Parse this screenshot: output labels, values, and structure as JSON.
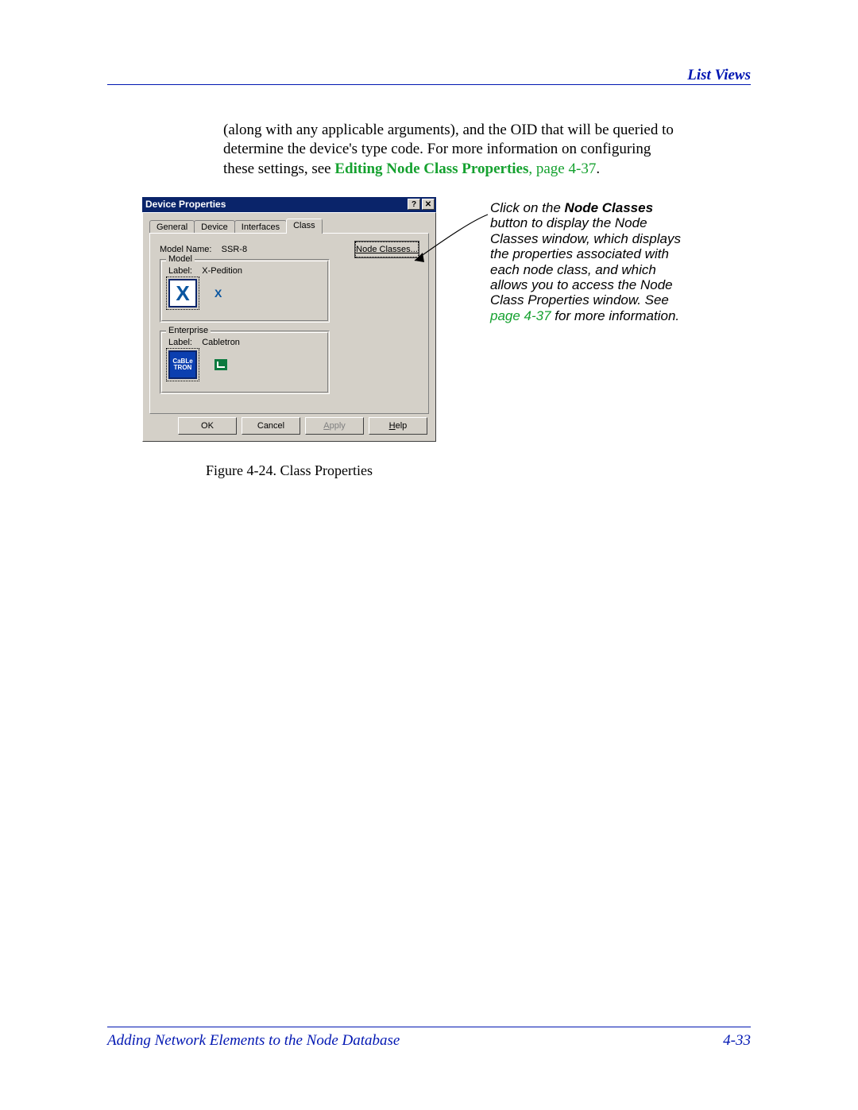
{
  "header": {
    "section": "List Views"
  },
  "paragraph": {
    "lead": "(along with any applicable arguments), and the OID that will be queried to determine the device's type code. For more information on configuring these settings, see ",
    "link": "Editing Node Class Properties",
    "link_tail": ", page 4-37",
    "end": "."
  },
  "dialog": {
    "title": "Device Properties",
    "help_btn": "?",
    "close_btn": "✕",
    "tabs": [
      "General",
      "Device",
      "Interfaces",
      "Class"
    ],
    "active_tab": "Class",
    "model_name_label": "Model Name:",
    "model_name_value": "SSR-8",
    "node_classes_btn_prefix": "N",
    "node_classes_btn_rest": "ode Classes...",
    "group_model": {
      "legend": "Model",
      "label_prefix": "Label:",
      "label_value": "X-Pedition"
    },
    "group_enterprise": {
      "legend": "Enterprise",
      "label_prefix": "Label:",
      "label_value": "Cabletron",
      "ct_line1": "CaBLe",
      "ct_line2": "TRON"
    },
    "buttons": {
      "ok": "OK",
      "cancel": "Cancel",
      "apply_prefix": "A",
      "apply_rest": "pply",
      "help_prefix": "H",
      "help_rest": "elp"
    }
  },
  "callout": {
    "t1": "Click on the ",
    "bold": "Node Classes",
    "t2": " button to display the Node Classes window, which displays the properties associated with each node class, and which allows you to access the Node Class Properties window. See ",
    "pg": "page 4-37",
    "t3": " for more information."
  },
  "figure_caption": "Figure 4-24. Class Properties",
  "footer": {
    "left": "Adding Network Elements to the Node Database",
    "right": "4-33"
  }
}
